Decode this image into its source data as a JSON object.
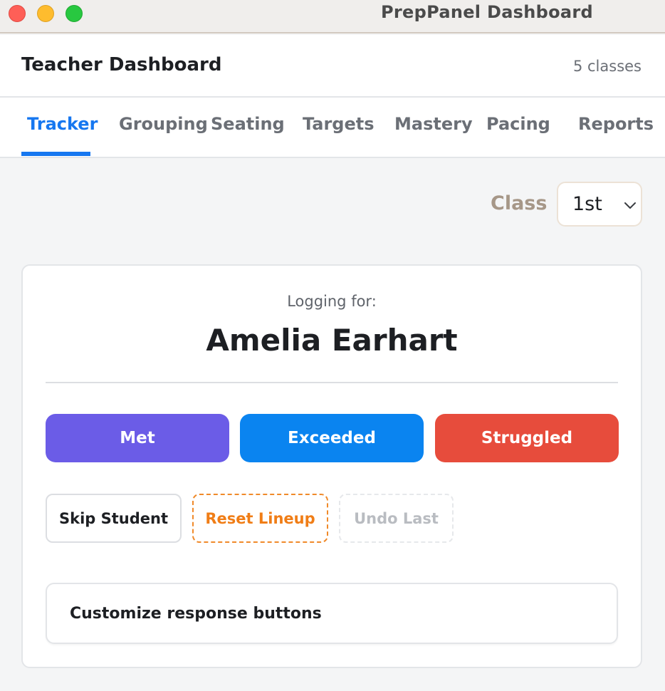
{
  "window": {
    "title": "PrepPanel Dashboard"
  },
  "header": {
    "title": "Teacher Dashboard",
    "class_count": "5 classes"
  },
  "tabs": [
    {
      "label": "Tracker",
      "active": true
    },
    {
      "label": "Grouping",
      "active": false
    },
    {
      "label": "Seating",
      "active": false
    },
    {
      "label": "Targets",
      "active": false
    },
    {
      "label": "Mastery",
      "active": false
    },
    {
      "label": "Pacing",
      "active": false
    },
    {
      "label": "Reports",
      "active": false
    }
  ],
  "class_selector": {
    "label": "Class",
    "value": "1st",
    "icon": "chevron-down-icon"
  },
  "logger": {
    "prompt": "Logging for:",
    "student_name": "Amelia Earhart",
    "responses": [
      {
        "label": "Met",
        "color": "#6b5ce7"
      },
      {
        "label": "Exceeded",
        "color": "#0a84f0"
      },
      {
        "label": "Struggled",
        "color": "#e74c3c"
      }
    ],
    "actions": {
      "skip": "Skip Student",
      "reset": "Reset Lineup",
      "undo": "Undo Last"
    },
    "customize_label": "Customize response buttons"
  },
  "colors": {
    "accent": "#1677f0",
    "reset_accent": "#f07d16"
  }
}
